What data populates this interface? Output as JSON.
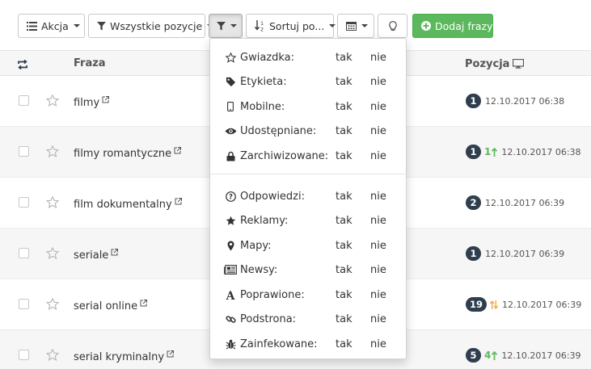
{
  "toolbar": {
    "action_label": "Akcja",
    "positions_label": "Wszystkie pozycje",
    "sort_label": "Sortuj po...",
    "add_label": "Dodaj frazy"
  },
  "table": {
    "col_phrase": "Fraza",
    "col_position": "Pozycja",
    "rows": [
      {
        "phrase": "filmy",
        "position": "1",
        "trend": "",
        "date": "12.10.2017 06:38"
      },
      {
        "phrase": "filmy romantyczne",
        "position": "1",
        "trend": "1",
        "date": "12.10.2017 06:38"
      },
      {
        "phrase": "film dokumentalny",
        "position": "2",
        "trend": "",
        "date": "12.10.2017 06:39"
      },
      {
        "phrase": "seriale",
        "position": "1",
        "trend": "",
        "date": "12.10.2017 06:39"
      },
      {
        "phrase": "serial online",
        "position": "19",
        "trend": "",
        "date": "12.10.2017 06:39"
      },
      {
        "phrase": "serial kryminalny",
        "position": "5",
        "trend": "4",
        "date": "12.10.2017 06:39"
      }
    ]
  },
  "filter_menu": {
    "yes": "tak",
    "no": "nie",
    "items": [
      {
        "label": "Gwiazdka:",
        "icon": "star-outline-icon"
      },
      {
        "label": "Etykieta:",
        "icon": "tag-icon"
      },
      {
        "label": "Mobilne:",
        "icon": "mobile-icon"
      },
      {
        "label": "Udostępniane:",
        "icon": "eye-icon"
      },
      {
        "label": "Zarchiwizowane:",
        "icon": "lock-icon"
      },
      {
        "label": "Odpowiedzi:",
        "icon": "question-circle-icon"
      },
      {
        "label": "Reklamy:",
        "icon": "star-icon"
      },
      {
        "label": "Mapy:",
        "icon": "map-marker-icon"
      },
      {
        "label": "Newsy:",
        "icon": "newspaper-icon"
      },
      {
        "label": "Poprawione:",
        "icon": "font-icon"
      },
      {
        "label": "Podstrona:",
        "icon": "link-icon"
      },
      {
        "label": "Zainfekowane:",
        "icon": "bug-icon"
      }
    ]
  },
  "colors": {
    "primary_dark": "#2f3e4e",
    "success": "#5cb85c",
    "warning": "#f0ad4e"
  }
}
